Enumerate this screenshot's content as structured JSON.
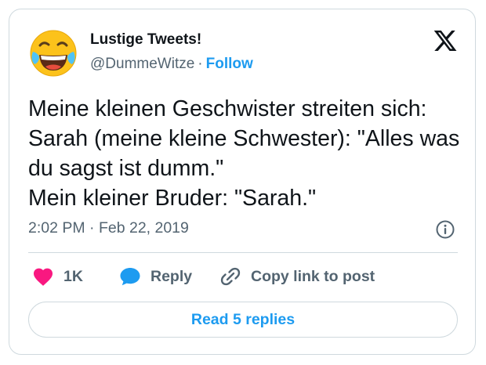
{
  "tweet": {
    "author": {
      "display_name": "Lustige Tweets!",
      "handle": "@DummeWitze",
      "separator": "·",
      "follow_label": "Follow",
      "avatar_icon": "face-with-tears-of-joy-emoji"
    },
    "platform_icon": "x-logo-icon",
    "text": "Meine kleinen Geschwister streiten sich:\nSarah (meine kleine Schwester): \"Alles was du sagst ist dumm.\"\nMein kleiner Bruder: \"Sarah.\"",
    "timestamp": "2:02 PM · Feb 22, 2019",
    "info_icon": "info-icon",
    "actions": {
      "like_count": "1K",
      "reply_label": "Reply",
      "copy_label": "Copy link to post"
    },
    "read_replies_label": "Read 5 replies"
  },
  "colors": {
    "text": "#0f1419",
    "secondary": "#536471",
    "accent": "#1d9bf0",
    "like": "#f91880",
    "border": "#cfd9de"
  }
}
